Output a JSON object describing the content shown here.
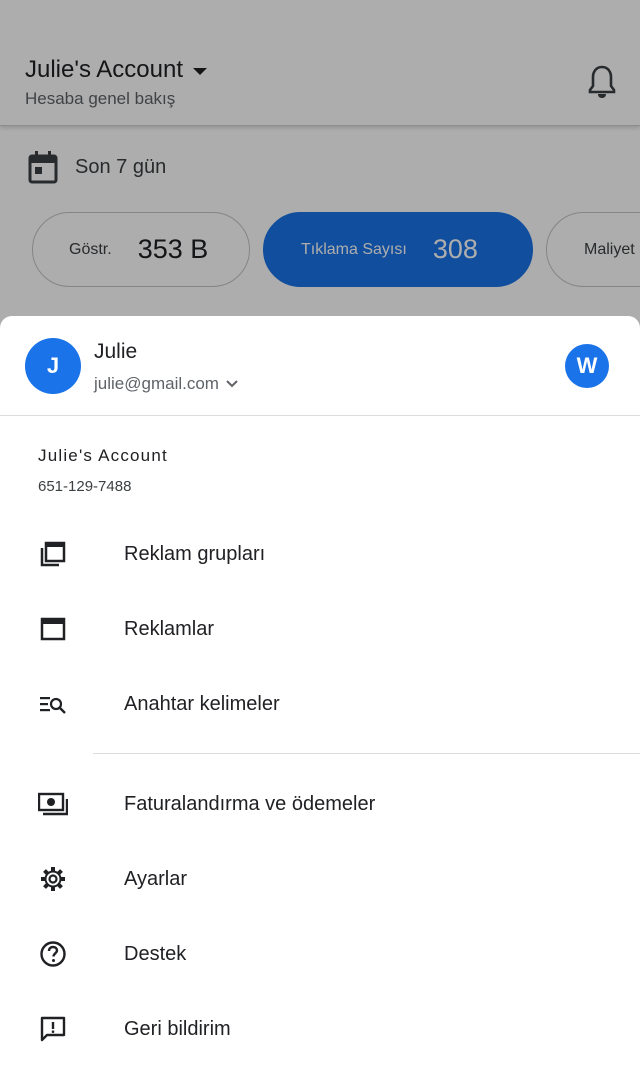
{
  "header": {
    "account_title": "Julie's Account",
    "subtitle": "Hesaba genel bakış"
  },
  "date_range": {
    "label": "Son 7 gün"
  },
  "metric_chips": [
    {
      "label": "Göstr.",
      "value": "353 B"
    },
    {
      "label": "Tıklama Sayısı",
      "value": "308"
    },
    {
      "label": "Maliyet",
      "value": ""
    }
  ],
  "sheet": {
    "user": {
      "initial": "J",
      "name": "Julie",
      "email": "julie@gmail.com",
      "secondary_initial": "W"
    },
    "account": {
      "name": "Julie's Account",
      "phone": "651-129-7488"
    },
    "menu_group_1": [
      {
        "label": "Reklam grupları",
        "icon": "ad-groups-icon"
      },
      {
        "label": "Reklamlar",
        "icon": "ads-icon"
      },
      {
        "label": "Anahtar kelimeler",
        "icon": "keywords-icon"
      }
    ],
    "menu_group_2": [
      {
        "label": "Faturalandırma ve ödemeler",
        "icon": "billing-icon"
      },
      {
        "label": "Ayarlar",
        "icon": "settings-icon"
      },
      {
        "label": "Destek",
        "icon": "help-icon"
      },
      {
        "label": "Geri bildirim",
        "icon": "feedback-icon"
      }
    ]
  },
  "colors": {
    "primary": "#1a73e8",
    "scrim": "rgba(0,0,0,0.32)"
  }
}
